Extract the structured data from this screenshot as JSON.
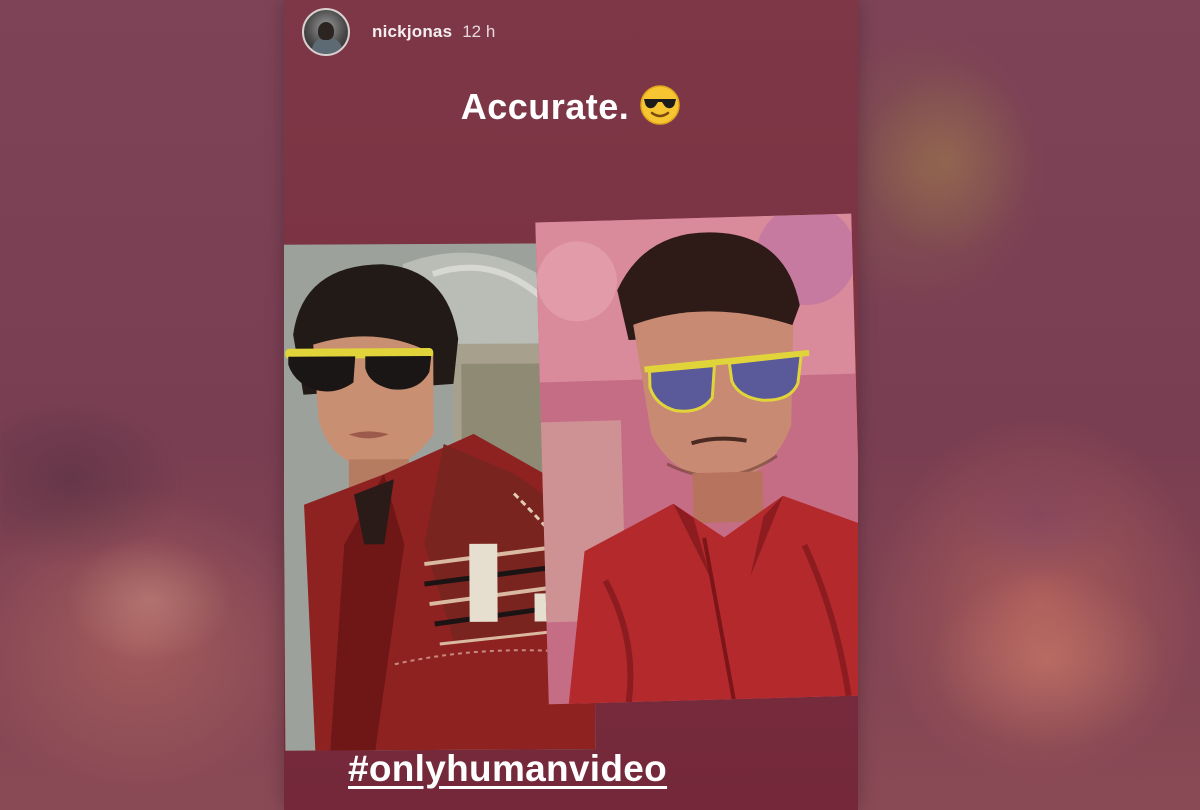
{
  "story": {
    "username": "nickjonas",
    "timestamp": "12 h",
    "caption": "Accurate.",
    "caption_emoji": "smiling-face-with-sunglasses-icon",
    "hashtag": "#onlyhumanvideo"
  },
  "colors": {
    "background": "#7a3c4e",
    "story_background": "#7b3342",
    "text": "#ffffff",
    "sunglasses_frame": "#e0d43a"
  }
}
